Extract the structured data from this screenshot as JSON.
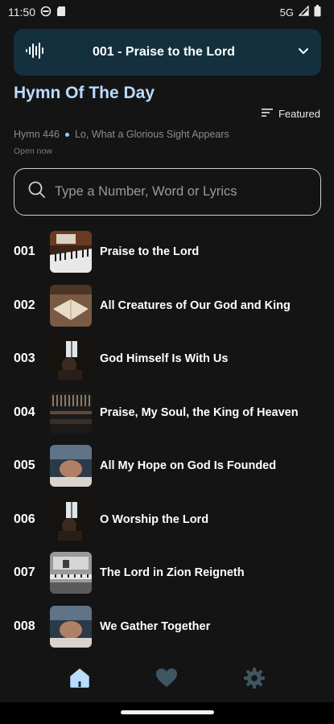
{
  "status_bar": {
    "time": "11:50",
    "network": "5G",
    "icons": [
      "vpn-icon",
      "sd-card-icon",
      "signal-icon",
      "battery-icon"
    ]
  },
  "now_playing": {
    "title": "001 - Praise to the Lord",
    "icon": "audio-wave-icon",
    "expand_icon": "chevron-down-icon"
  },
  "hymn_of_the_day": {
    "heading": "Hymn Of The Day",
    "hymn_number_label": "Hymn 446",
    "hymn_title": "Lo, What a Glorious Sight Appears",
    "status": "Open now"
  },
  "filter": {
    "label": "Featured",
    "icon": "sort-lines-icon"
  },
  "search": {
    "placeholder": "Type a Number, Word or Lyrics",
    "value": ""
  },
  "hymns": [
    {
      "number": "001",
      "title": "Praise to the Lord",
      "thumb": "piano-keys"
    },
    {
      "number": "002",
      "title": "All Creatures of Our God and King",
      "thumb": "open-bible"
    },
    {
      "number": "003",
      "title": "God Himself Is With Us",
      "thumb": "dark-window"
    },
    {
      "number": "004",
      "title": "Praise, My Soul, the King of Heaven",
      "thumb": "organ-pipes"
    },
    {
      "number": "005",
      "title": "All My Hope on God Is Founded",
      "thumb": "praying-hands"
    },
    {
      "number": "006",
      "title": "O Worship the Lord",
      "thumb": "dark-window"
    },
    {
      "number": "007",
      "title": "The Lord in Zion Reigneth",
      "thumb": "gray-piano"
    },
    {
      "number": "008",
      "title": "We Gather Together",
      "thumb": "praying-hands"
    }
  ],
  "bottom_nav": [
    {
      "name": "home",
      "icon": "home-icon",
      "active": true
    },
    {
      "name": "favorites",
      "icon": "heart-icon",
      "active": false
    },
    {
      "name": "settings",
      "icon": "gear-icon",
      "active": false
    }
  ],
  "colors": {
    "background": "#141414",
    "accent": "#b9dcff",
    "now_playing_bg": "#14303e",
    "nav_active": "#b9dcff",
    "nav_inactive": "#3f5562"
  }
}
